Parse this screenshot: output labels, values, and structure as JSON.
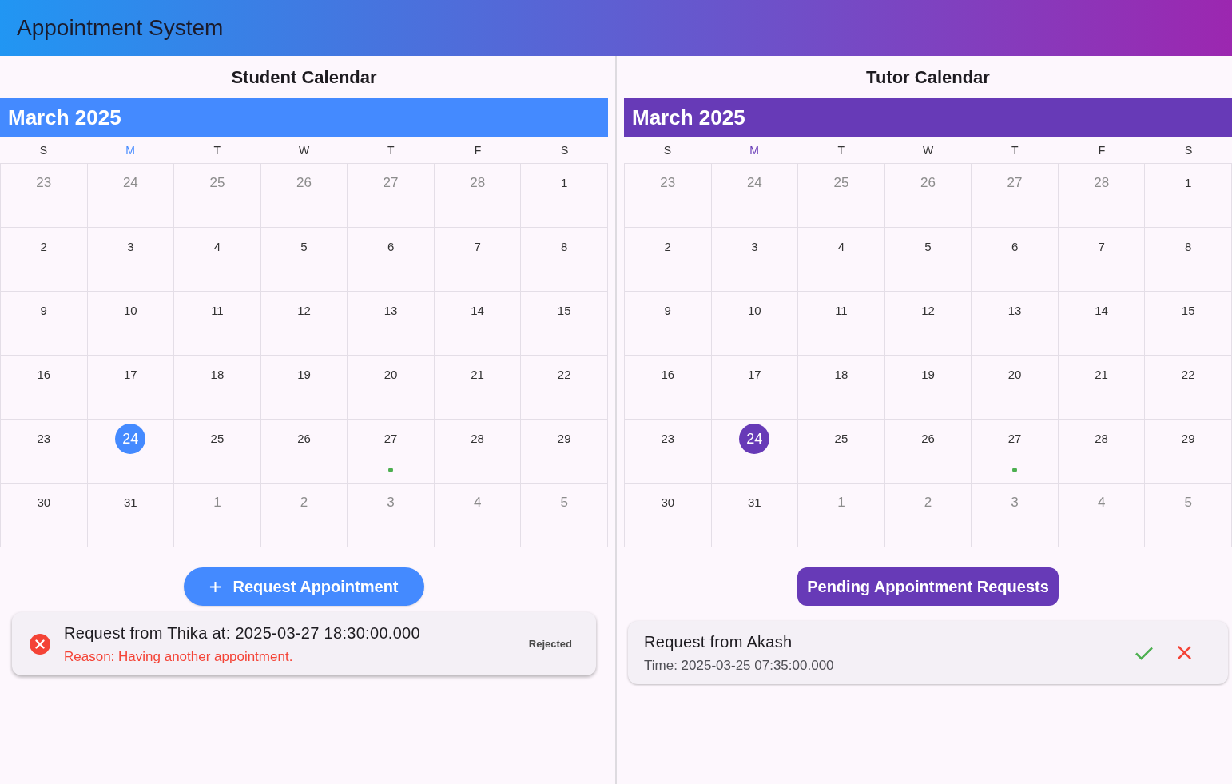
{
  "app_bar": {
    "title": "Appointment System"
  },
  "panels": [
    {
      "title": "Student Calendar",
      "color": "#448aff",
      "calendar": {
        "month": "March 2025",
        "weekdays": [
          {
            "label": "S",
            "current": false
          },
          {
            "label": "M",
            "current": true
          },
          {
            "label": "T",
            "current": false
          },
          {
            "label": "W",
            "current": false
          },
          {
            "label": "T",
            "current": false
          },
          {
            "label": "F",
            "current": false
          },
          {
            "label": "S",
            "current": false
          }
        ],
        "weeks": [
          [
            {
              "day": "23",
              "in_month": false,
              "today": false,
              "has_event": false
            },
            {
              "day": "24",
              "in_month": false,
              "today": false,
              "has_event": false
            },
            {
              "day": "25",
              "in_month": false,
              "today": false,
              "has_event": false
            },
            {
              "day": "26",
              "in_month": false,
              "today": false,
              "has_event": false
            },
            {
              "day": "27",
              "in_month": false,
              "today": false,
              "has_event": false
            },
            {
              "day": "28",
              "in_month": false,
              "today": false,
              "has_event": false
            },
            {
              "day": "1",
              "in_month": true,
              "today": false,
              "has_event": false
            }
          ],
          [
            {
              "day": "2",
              "in_month": true,
              "today": false,
              "has_event": false
            },
            {
              "day": "3",
              "in_month": true,
              "today": false,
              "has_event": false
            },
            {
              "day": "4",
              "in_month": true,
              "today": false,
              "has_event": false
            },
            {
              "day": "5",
              "in_month": true,
              "today": false,
              "has_event": false
            },
            {
              "day": "6",
              "in_month": true,
              "today": false,
              "has_event": false
            },
            {
              "day": "7",
              "in_month": true,
              "today": false,
              "has_event": false
            },
            {
              "day": "8",
              "in_month": true,
              "today": false,
              "has_event": false
            }
          ],
          [
            {
              "day": "9",
              "in_month": true,
              "today": false,
              "has_event": false
            },
            {
              "day": "10",
              "in_month": true,
              "today": false,
              "has_event": false
            },
            {
              "day": "11",
              "in_month": true,
              "today": false,
              "has_event": false
            },
            {
              "day": "12",
              "in_month": true,
              "today": false,
              "has_event": false
            },
            {
              "day": "13",
              "in_month": true,
              "today": false,
              "has_event": false
            },
            {
              "day": "14",
              "in_month": true,
              "today": false,
              "has_event": false
            },
            {
              "day": "15",
              "in_month": true,
              "today": false,
              "has_event": false
            }
          ],
          [
            {
              "day": "16",
              "in_month": true,
              "today": false,
              "has_event": false
            },
            {
              "day": "17",
              "in_month": true,
              "today": false,
              "has_event": false
            },
            {
              "day": "18",
              "in_month": true,
              "today": false,
              "has_event": false
            },
            {
              "day": "19",
              "in_month": true,
              "today": false,
              "has_event": false
            },
            {
              "day": "20",
              "in_month": true,
              "today": false,
              "has_event": false
            },
            {
              "day": "21",
              "in_month": true,
              "today": false,
              "has_event": false
            },
            {
              "day": "22",
              "in_month": true,
              "today": false,
              "has_event": false
            }
          ],
          [
            {
              "day": "23",
              "in_month": true,
              "today": false,
              "has_event": false
            },
            {
              "day": "24",
              "in_month": true,
              "today": true,
              "has_event": false
            },
            {
              "day": "25",
              "in_month": true,
              "today": false,
              "has_event": false
            },
            {
              "day": "26",
              "in_month": true,
              "today": false,
              "has_event": false
            },
            {
              "day": "27",
              "in_month": true,
              "today": false,
              "has_event": true
            },
            {
              "day": "28",
              "in_month": true,
              "today": false,
              "has_event": false
            },
            {
              "day": "29",
              "in_month": true,
              "today": false,
              "has_event": false
            }
          ],
          [
            {
              "day": "30",
              "in_month": true,
              "today": false,
              "has_event": false
            },
            {
              "day": "31",
              "in_month": true,
              "today": false,
              "has_event": false
            },
            {
              "day": "1",
              "in_month": false,
              "today": false,
              "has_event": false
            },
            {
              "day": "2",
              "in_month": false,
              "today": false,
              "has_event": false
            },
            {
              "day": "3",
              "in_month": false,
              "today": false,
              "has_event": false
            },
            {
              "day": "4",
              "in_month": false,
              "today": false,
              "has_event": false
            },
            {
              "day": "5",
              "in_month": false,
              "today": false,
              "has_event": false
            }
          ]
        ]
      },
      "action": {
        "kind": "add",
        "label": "Request Appointment"
      },
      "requests": [
        {
          "kind": "rejected",
          "title": "Request from Thika at: 2025-03-27 18:30:00.000",
          "detail": "Reason: Having another appointment.",
          "status_label": "Rejected"
        }
      ]
    },
    {
      "title": "Tutor Calendar",
      "color": "#673ab7",
      "calendar": {
        "month": "March 2025",
        "weekdays": [
          {
            "label": "S",
            "current": false
          },
          {
            "label": "M",
            "current": true
          },
          {
            "label": "T",
            "current": false
          },
          {
            "label": "W",
            "current": false
          },
          {
            "label": "T",
            "current": false
          },
          {
            "label": "F",
            "current": false
          },
          {
            "label": "S",
            "current": false
          }
        ],
        "weeks": [
          [
            {
              "day": "23",
              "in_month": false,
              "today": false,
              "has_event": false
            },
            {
              "day": "24",
              "in_month": false,
              "today": false,
              "has_event": false
            },
            {
              "day": "25",
              "in_month": false,
              "today": false,
              "has_event": false
            },
            {
              "day": "26",
              "in_month": false,
              "today": false,
              "has_event": false
            },
            {
              "day": "27",
              "in_month": false,
              "today": false,
              "has_event": false
            },
            {
              "day": "28",
              "in_month": false,
              "today": false,
              "has_event": false
            },
            {
              "day": "1",
              "in_month": true,
              "today": false,
              "has_event": false
            }
          ],
          [
            {
              "day": "2",
              "in_month": true,
              "today": false,
              "has_event": false
            },
            {
              "day": "3",
              "in_month": true,
              "today": false,
              "has_event": false
            },
            {
              "day": "4",
              "in_month": true,
              "today": false,
              "has_event": false
            },
            {
              "day": "5",
              "in_month": true,
              "today": false,
              "has_event": false
            },
            {
              "day": "6",
              "in_month": true,
              "today": false,
              "has_event": false
            },
            {
              "day": "7",
              "in_month": true,
              "today": false,
              "has_event": false
            },
            {
              "day": "8",
              "in_month": true,
              "today": false,
              "has_event": false
            }
          ],
          [
            {
              "day": "9",
              "in_month": true,
              "today": false,
              "has_event": false
            },
            {
              "day": "10",
              "in_month": true,
              "today": false,
              "has_event": false
            },
            {
              "day": "11",
              "in_month": true,
              "today": false,
              "has_event": false
            },
            {
              "day": "12",
              "in_month": true,
              "today": false,
              "has_event": false
            },
            {
              "day": "13",
              "in_month": true,
              "today": false,
              "has_event": false
            },
            {
              "day": "14",
              "in_month": true,
              "today": false,
              "has_event": false
            },
            {
              "day": "15",
              "in_month": true,
              "today": false,
              "has_event": false
            }
          ],
          [
            {
              "day": "16",
              "in_month": true,
              "today": false,
              "has_event": false
            },
            {
              "day": "17",
              "in_month": true,
              "today": false,
              "has_event": false
            },
            {
              "day": "18",
              "in_month": true,
              "today": false,
              "has_event": false
            },
            {
              "day": "19",
              "in_month": true,
              "today": false,
              "has_event": false
            },
            {
              "day": "20",
              "in_month": true,
              "today": false,
              "has_event": false
            },
            {
              "day": "21",
              "in_month": true,
              "today": false,
              "has_event": false
            },
            {
              "day": "22",
              "in_month": true,
              "today": false,
              "has_event": false
            }
          ],
          [
            {
              "day": "23",
              "in_month": true,
              "today": false,
              "has_event": false
            },
            {
              "day": "24",
              "in_month": true,
              "today": true,
              "has_event": false
            },
            {
              "day": "25",
              "in_month": true,
              "today": false,
              "has_event": false
            },
            {
              "day": "26",
              "in_month": true,
              "today": false,
              "has_event": false
            },
            {
              "day": "27",
              "in_month": true,
              "today": false,
              "has_event": true
            },
            {
              "day": "28",
              "in_month": true,
              "today": false,
              "has_event": false
            },
            {
              "day": "29",
              "in_month": true,
              "today": false,
              "has_event": false
            }
          ],
          [
            {
              "day": "30",
              "in_month": true,
              "today": false,
              "has_event": false
            },
            {
              "day": "31",
              "in_month": true,
              "today": false,
              "has_event": false
            },
            {
              "day": "1",
              "in_month": false,
              "today": false,
              "has_event": false
            },
            {
              "day": "2",
              "in_month": false,
              "today": false,
              "has_event": false
            },
            {
              "day": "3",
              "in_month": false,
              "today": false,
              "has_event": false
            },
            {
              "day": "4",
              "in_month": false,
              "today": false,
              "has_event": false
            },
            {
              "day": "5",
              "in_month": false,
              "today": false,
              "has_event": false
            }
          ]
        ]
      },
      "action": {
        "kind": "header",
        "label": "Pending Appointment Requests"
      },
      "requests": [
        {
          "kind": "pending",
          "title": "Request from Akash",
          "detail": "Time: 2025-03-25 07:35:00.000"
        }
      ]
    }
  ]
}
